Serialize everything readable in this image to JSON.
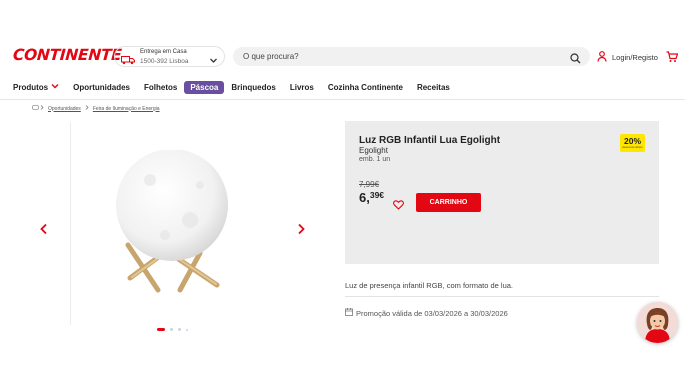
{
  "brand": {
    "logo_text": "CONTINENTE",
    "color": "#e30613"
  },
  "header": {
    "delivery": {
      "line1": "Entrega em Casa",
      "line2": "1500-392 Lisboa",
      "icon": "truck-icon"
    },
    "search": {
      "placeholder": "O que procura?",
      "icon": "search-icon"
    },
    "login": {
      "label": "Login/Registo",
      "icon": "user-icon"
    },
    "cart_icon": "cart-icon"
  },
  "nav": {
    "items": [
      {
        "label": "Produtos"
      },
      {
        "label": "Oportunidades"
      },
      {
        "label": "Folhetos"
      },
      {
        "label": "Páscoa",
        "active": true
      },
      {
        "label": "Brinquedos"
      },
      {
        "label": "Livros"
      },
      {
        "label": "Cozinha Continente"
      },
      {
        "label": "Receitas"
      }
    ],
    "active_color": "#6a4fa0"
  },
  "breadcrumb": {
    "items": [
      "Oportunidades",
      "Feira de Iluminação e Energia"
    ]
  },
  "gallery": {
    "dot_count": 4,
    "active_dot": 0,
    "image_icon": "moon-lamp-image"
  },
  "product": {
    "title": "Luz RGB Infantil Lua Egolight",
    "brand": "Egolight",
    "unit": "emb. 1 un",
    "discount_badge": "20%",
    "discount_badge_sub": "desconto direto",
    "old_price": "7,99€",
    "price_int": "6,",
    "price_cents": "39€",
    "cart_button": "CARRINHO",
    "description": "Luz de presença infantil RGB, com formato de lua.",
    "promo": "Promoção válida de 03/03/2026 a 30/03/2026"
  }
}
